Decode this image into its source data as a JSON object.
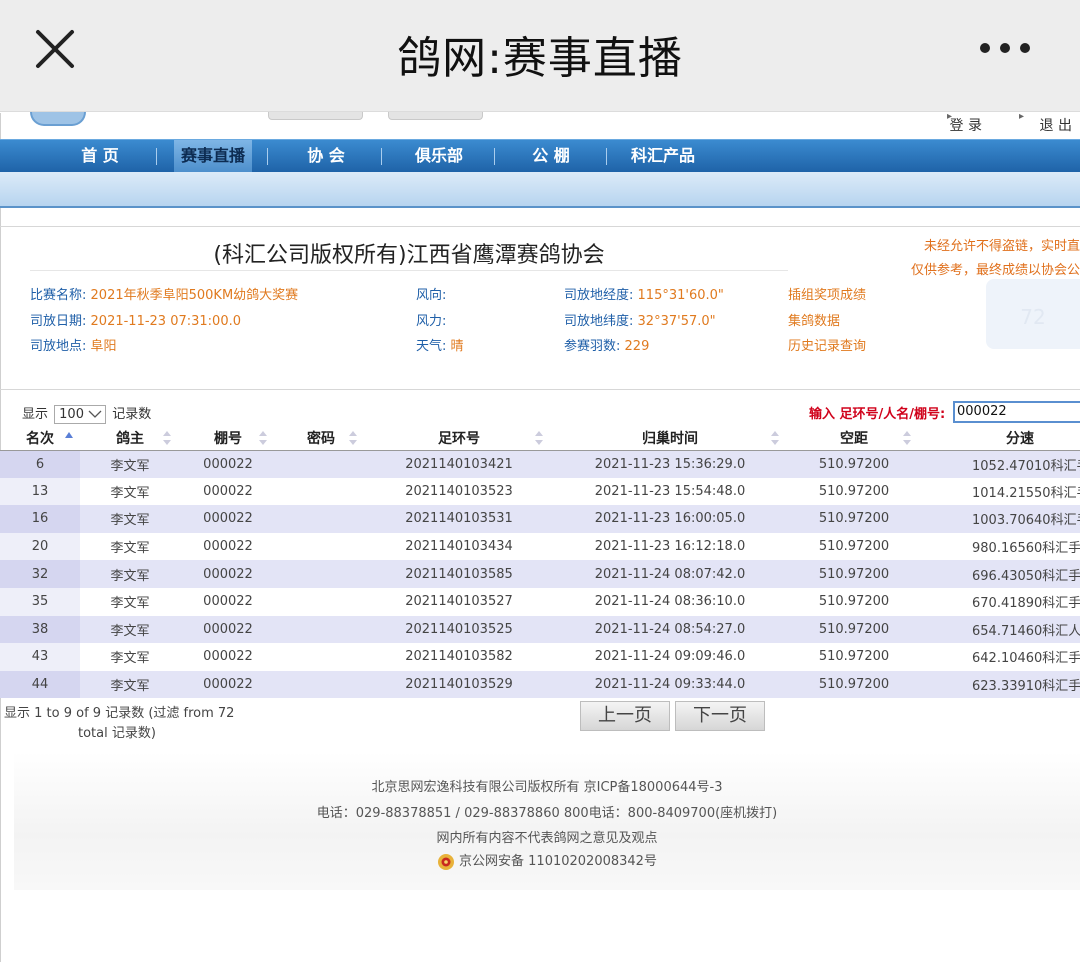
{
  "appbar": {
    "title": "鸽网:赛事直播",
    "close_icon": "close-icon",
    "more_icon": "more-dots-icon"
  },
  "header": {
    "login": "登 录",
    "logout": "退 出"
  },
  "nav": {
    "items": [
      "首 页",
      "赛事直播",
      "协 会",
      "俱乐部",
      "公 棚",
      "科汇产品"
    ],
    "active_index": 1
  },
  "info": {
    "heading": "(科汇公司版权所有)江西省鹰潭赛鸽协会",
    "notice_line1": "未经允许不得盗链，实时直",
    "notice_line2": "仅供参考，最终成绩以协会公",
    "badge_number": "72",
    "race_name_label": "比赛名称:",
    "race_name": "2021年秋季阜阳500KM幼鸽大奖赛",
    "release_date_label": "司放日期:",
    "release_date": "2021-11-23 07:31:00.0",
    "release_place_label": "司放地点:",
    "release_place": "阜阳",
    "wind_dir_label": "风向:",
    "wind_dir": "",
    "wind_force_label": "风力:",
    "wind_force": "",
    "weather_label": "天气:",
    "weather": "晴",
    "longitude_label": "司放地经度:",
    "longitude": "115°31'60.0\"",
    "latitude_label": "司放地纬度:",
    "latitude": "32°37'57.0\"",
    "entries_label": "参赛羽数:",
    "entries": "229",
    "links": [
      "插组奖项成绩",
      "集鸽数据",
      "历史记录查询"
    ]
  },
  "controls": {
    "show_prefix": "显示",
    "page_size": "100",
    "show_suffix": "记录数",
    "search_label": "输入 足环号/人名/棚号:",
    "search_value": "000022"
  },
  "table": {
    "headers": [
      "名次",
      "鸽主",
      "棚号",
      "密码",
      "足环号",
      "归巢时间",
      "空距",
      "分速"
    ],
    "rows": [
      [
        "6",
        "李文军",
        "000022",
        "",
        "2021140103421",
        "2021-11-23 15:36:29.0",
        "510.97200",
        "1052.47010科汇手"
      ],
      [
        "13",
        "李文军",
        "000022",
        "",
        "2021140103523",
        "2021-11-23 15:54:48.0",
        "510.97200",
        "1014.21550科汇手"
      ],
      [
        "16",
        "李文军",
        "000022",
        "",
        "2021140103531",
        "2021-11-23 16:00:05.0",
        "510.97200",
        "1003.70640科汇手"
      ],
      [
        "20",
        "李文军",
        "000022",
        "",
        "2021140103434",
        "2021-11-23 16:12:18.0",
        "510.97200",
        "980.16560科汇手"
      ],
      [
        "32",
        "李文军",
        "000022",
        "",
        "2021140103585",
        "2021-11-24 08:07:42.0",
        "510.97200",
        "696.43050科汇手"
      ],
      [
        "35",
        "李文军",
        "000022",
        "",
        "2021140103527",
        "2021-11-24 08:36:10.0",
        "510.97200",
        "670.41890科汇手"
      ],
      [
        "38",
        "李文军",
        "000022",
        "",
        "2021140103525",
        "2021-11-24 08:54:27.0",
        "510.97200",
        "654.71460科汇人"
      ],
      [
        "43",
        "李文军",
        "000022",
        "",
        "2021140103582",
        "2021-11-24 09:09:46.0",
        "510.97200",
        "642.10460科汇手"
      ],
      [
        "44",
        "李文军",
        "000022",
        "",
        "2021140103529",
        "2021-11-24 09:33:44.0",
        "510.97200",
        "623.33910科汇手"
      ]
    ]
  },
  "summary": {
    "line1": "显示 1 to 9 of 9 记录数 (过滤 from 72",
    "line2": "total 记录数)"
  },
  "pager": {
    "prev": "上一页",
    "next": "下一页"
  },
  "footer": {
    "copyright": "北京思网宏逸科技有限公司版权所有 京ICP备18000644号-3",
    "phone": "电话：029-88378851 / 029-88378860    800电话：800-8409700(座机拨打)",
    "disclaimer": "网内所有内容不代表鸽网之意见及观点",
    "police": "京公网安备 11010202008342号"
  }
}
